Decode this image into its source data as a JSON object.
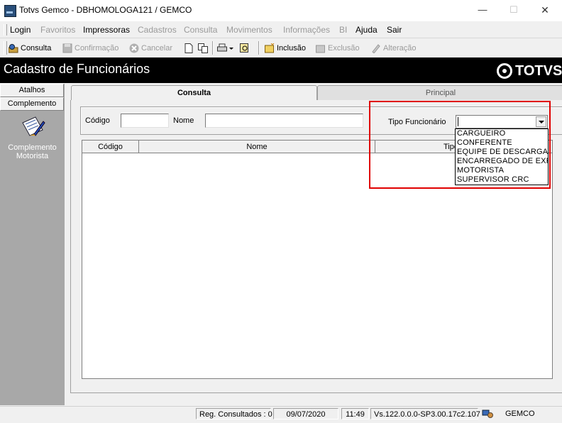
{
  "window": {
    "title": "Totvs Gemco - DBHOMOLOGA121 / GEMCO",
    "min_glyph": "—",
    "max_glyph": "☐",
    "close_glyph": "✕"
  },
  "menu": {
    "items": [
      {
        "label": "Login",
        "enabled": true
      },
      {
        "label": "Favoritos",
        "enabled": false
      },
      {
        "label": "Impressoras",
        "enabled": true
      },
      {
        "label": "Cadastros",
        "enabled": false
      },
      {
        "label": "Consulta",
        "enabled": false
      },
      {
        "label": "Movimentos",
        "enabled": false
      },
      {
        "label": "Informações",
        "enabled": false
      },
      {
        "label": "BI",
        "enabled": false
      },
      {
        "label": "Ajuda",
        "enabled": true
      },
      {
        "label": "Sair",
        "enabled": true
      }
    ]
  },
  "toolbar": {
    "consulta": "Consulta",
    "confirmacao": "Confirmação",
    "cancelar": "Cancelar",
    "inclusao": "Inclusão",
    "exclusao": "Exclusão",
    "alteracao": "Alteração"
  },
  "banner": {
    "title": "Cadastro de Funcionários",
    "logo_text": "TOTVS"
  },
  "sidebar": {
    "tab1": "Atalhos",
    "tab2": "Complemento",
    "item_label_line1": "Complemento",
    "item_label_line2": "Motorista",
    "item_icon": "clipboard-pencil-icon"
  },
  "tabs": {
    "active": "Consulta",
    "inactive": "Principal"
  },
  "filters": {
    "codigo_label": "Código",
    "codigo_value": "",
    "nome_label": "Nome",
    "nome_value": "",
    "tipo_label": "Tipo Funcionário",
    "tipo_value": ""
  },
  "dropdown": {
    "options": [
      "CARGUEIRO",
      "CONFERENTE",
      "EQUIPE DE DESCARGA",
      "ENCARREGADO DE EXPE",
      "MOTORISTA",
      "SUPERVISOR CRC"
    ]
  },
  "grid": {
    "columns": [
      "Código",
      "Nome",
      "Tipo Funcio"
    ],
    "rows": []
  },
  "status": {
    "reg": "Reg. Consultados : 0",
    "date": "09/07/2020",
    "time": "11:49",
    "version": "Vs.122.0.0.0-SP3.00.17c2.107",
    "user": "GEMCO"
  },
  "colors": {
    "highlight": "#e00000",
    "banner_bg": "#000000",
    "sidebar_bg": "#a8a8a8"
  }
}
